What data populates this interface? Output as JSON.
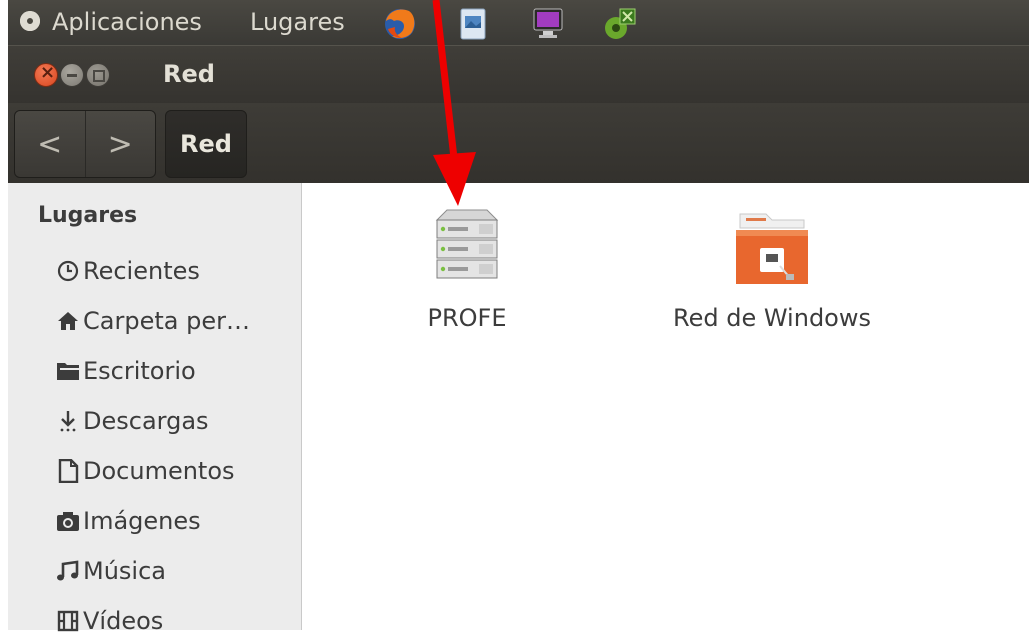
{
  "top_panel": {
    "menu_applications": "Aplicaciones",
    "menu_places": "Lugares",
    "launchers": [
      "firefox-icon",
      "image-viewer-icon",
      "monitor-icon",
      "game-icon"
    ]
  },
  "window": {
    "title": "Red"
  },
  "toolbar": {
    "back_label": "<",
    "forward_label": ">",
    "path_label": "Red"
  },
  "sidebar": {
    "heading": "Lugares",
    "items": [
      {
        "label": "Recientes",
        "icon": "clock-icon"
      },
      {
        "label": "Carpeta per…",
        "icon": "home-icon"
      },
      {
        "label": "Escritorio",
        "icon": "desktop-folder-icon"
      },
      {
        "label": "Descargas",
        "icon": "download-icon"
      },
      {
        "label": "Documentos",
        "icon": "document-icon"
      },
      {
        "label": "Imágenes",
        "icon": "camera-icon"
      },
      {
        "label": "Música",
        "icon": "music-icon"
      },
      {
        "label": "Vídeos",
        "icon": "film-icon"
      }
    ]
  },
  "content": {
    "items": [
      {
        "label": "PROFE",
        "icon": "server-icon"
      },
      {
        "label": "Red de Windows",
        "icon": "network-folder-icon"
      }
    ]
  },
  "colors": {
    "panel_bg": "#3c3b37",
    "close_button": "#e05a30",
    "sidebar_bg": "#ececec",
    "arrow": "#ee0000",
    "folder_orange": "#e8672e"
  }
}
